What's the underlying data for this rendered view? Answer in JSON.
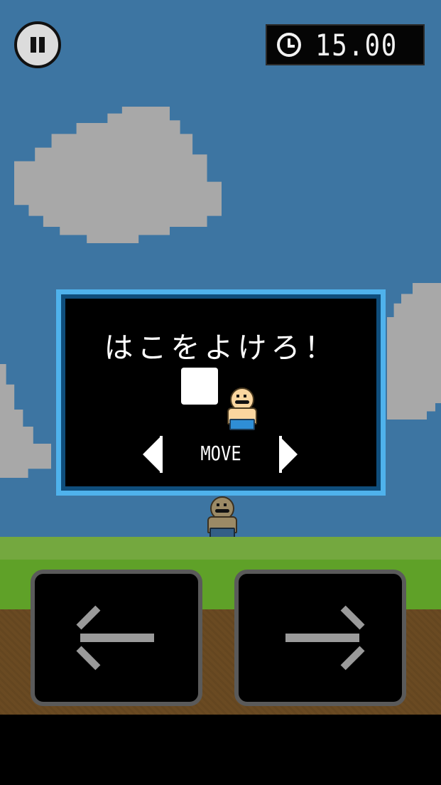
{
  "hud": {
    "pause_icon": "pause-icon",
    "timer_icon": "clock-icon",
    "timer_value": "15.00"
  },
  "dialog": {
    "title": "はこをよけろ！",
    "move_label": "MOVE",
    "border_color": "#4fb2ec"
  },
  "controls": {
    "left_icon": "arrow-left-icon",
    "right_icon": "arrow-right-icon"
  },
  "colors": {
    "sky": "#3d75a2",
    "cloud": "#a8a8a8",
    "grass": "#5fa128",
    "dirt": "#6a4a22"
  }
}
